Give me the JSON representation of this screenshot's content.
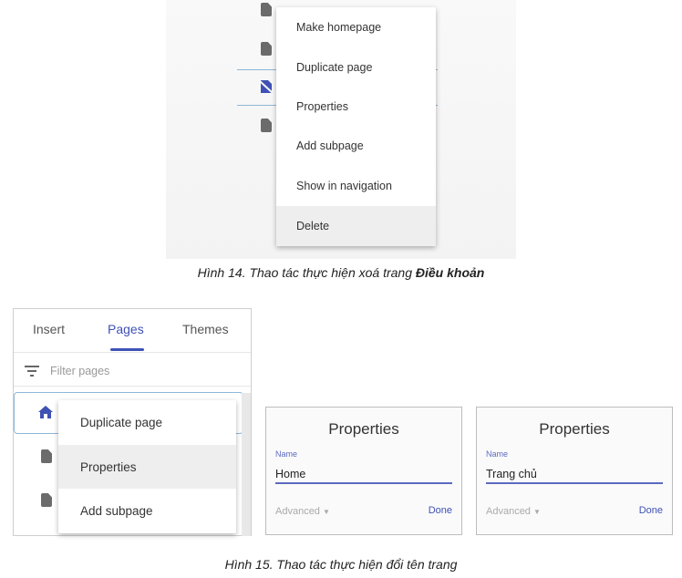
{
  "figure14": {
    "menu_items": [
      "Make homepage",
      "Duplicate page",
      "Properties",
      "Add subpage",
      "Show in navigation",
      "Delete"
    ],
    "highlighted": "Delete",
    "caption_prefix": "Hình 14. Thao tác thực hiện xoá trang ",
    "caption_bold": "Điều khoản"
  },
  "figure15": {
    "tabs": [
      "Insert",
      "Pages",
      "Themes"
    ],
    "active_tab": "Pages",
    "filter_placeholder": "Filter pages",
    "menu_items": [
      "Duplicate page",
      "Properties",
      "Add subpage"
    ],
    "highlighted": "Properties",
    "dialogs": [
      {
        "title": "Properties",
        "name_label": "Name",
        "name_value": "Home",
        "advanced": "Advanced",
        "done": "Done"
      },
      {
        "title": "Properties",
        "name_label": "Name",
        "name_value": "Trang chủ",
        "advanced": "Advanced",
        "done": "Done"
      }
    ],
    "caption": "Hình 15. Thao tác thực hiện đổi tên trang"
  },
  "colors": {
    "accent": "#3f51b5",
    "highlight": "#eeeeee"
  }
}
